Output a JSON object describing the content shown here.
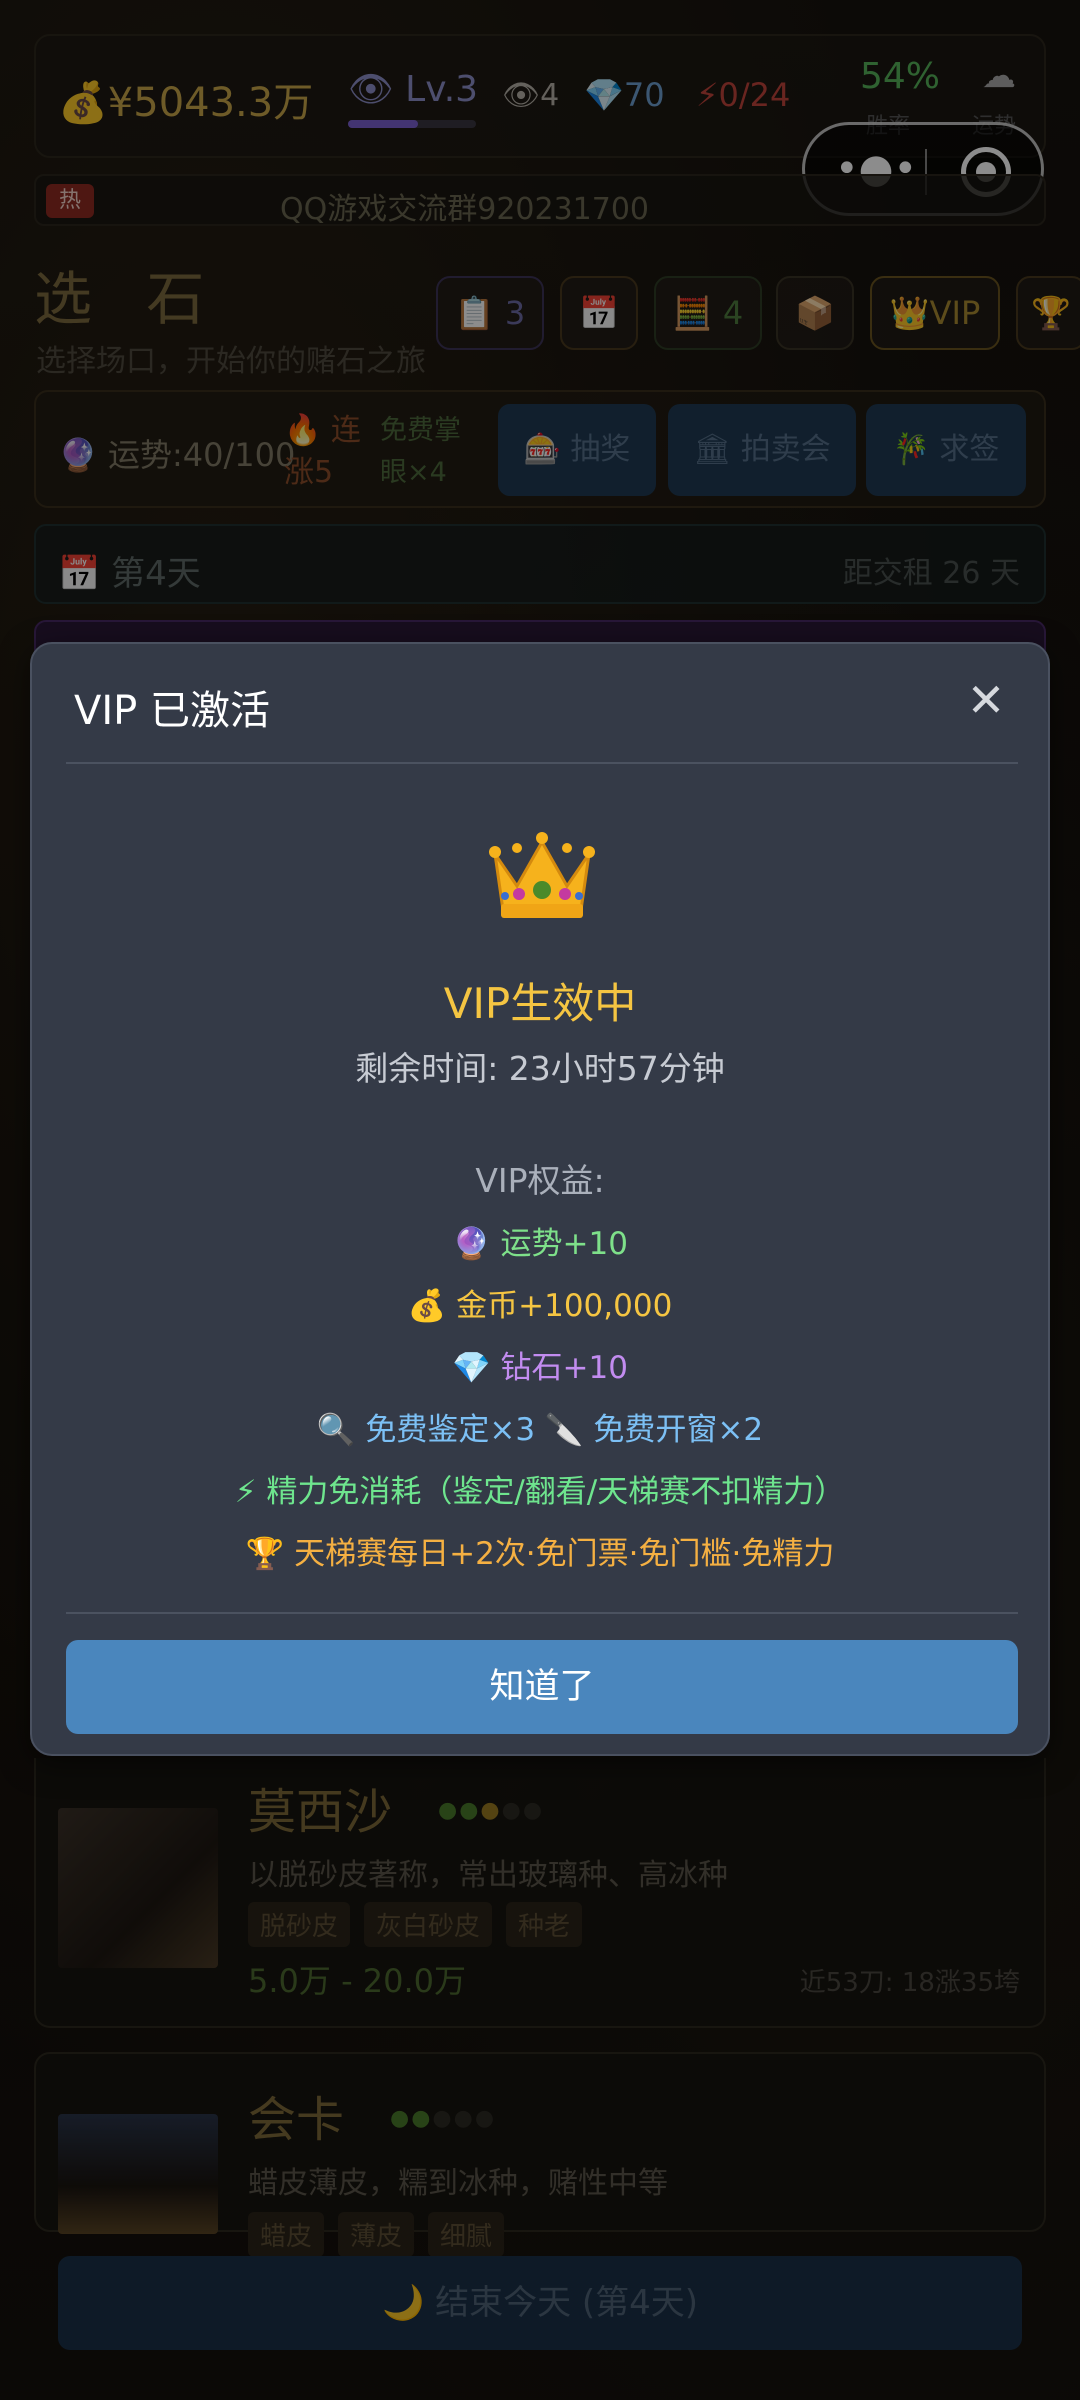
{
  "statusbar": {
    "money": "💰¥5043.3万",
    "level": "👁 Lv.3",
    "eye_count": "👁4",
    "gems": "💎70",
    "energy": "⚡0/24",
    "win_rate": "54%",
    "win_rate_label": "胜率",
    "luck_icon": "☁",
    "luck_label": "运势"
  },
  "banner": {
    "hot_label": "热",
    "text": "QQ游戏交流群920231700"
  },
  "header": {
    "title": "选 石",
    "subtitle": "选择场口，开始你的赌石之旅"
  },
  "toolbar": {
    "clipboard": "📋 3",
    "calendar": "📅",
    "abacus": "🧮 4",
    "box": "📦",
    "vip": "👑VIP",
    "trophy": "🏆"
  },
  "luck_row": {
    "luck": "🔮 运势:40/100",
    "streak": "🔥 连涨5",
    "free_eye": "免费掌眼×4",
    "lottery": "🎰 抽奖",
    "auction": "🏛 拍卖会",
    "fortune": "🎋 求签"
  },
  "day_row": {
    "day": "📅 第4天",
    "rent": "距交租 26 天"
  },
  "stones": [
    {
      "name": "莫西沙",
      "desc": "以脱砂皮著称，常出玻璃种、高冰种",
      "tags": [
        "脱砂皮",
        "灰白砂皮",
        "种老"
      ],
      "price": "5.0万 - 20.0万",
      "history": "近53刀: 18涨35垮"
    },
    {
      "name": "会卡",
      "desc": "蜡皮薄皮，糯到冰种，赌性中等",
      "tags": [
        "蜡皮",
        "薄皮",
        "细腻"
      ]
    }
  ],
  "end_button": "🌙 结束今天 (第4天)",
  "modal": {
    "title": "VIP 已激活",
    "close": "✕",
    "crown": "👑",
    "status": "VIP生效中",
    "remaining": "剩余时间: 23小时57分钟",
    "perks_heading": "VIP权益:",
    "perks": [
      "🔮 运势+10",
      "💰 金币+100,000",
      "💎 钻石+10",
      "🔍 免费鉴定×3  🔪 免费开窗×2",
      "⚡ 精力免消耗（鉴定/翻看/天梯赛不扣精力）",
      "🏆 天梯赛每日+2次·免门票·免门槛·免精力"
    ],
    "ok_button": "知道了"
  },
  "colors": {
    "modal_bg": "#343a47",
    "gold": "#f5c542",
    "button_blue": "#4a86bd"
  }
}
